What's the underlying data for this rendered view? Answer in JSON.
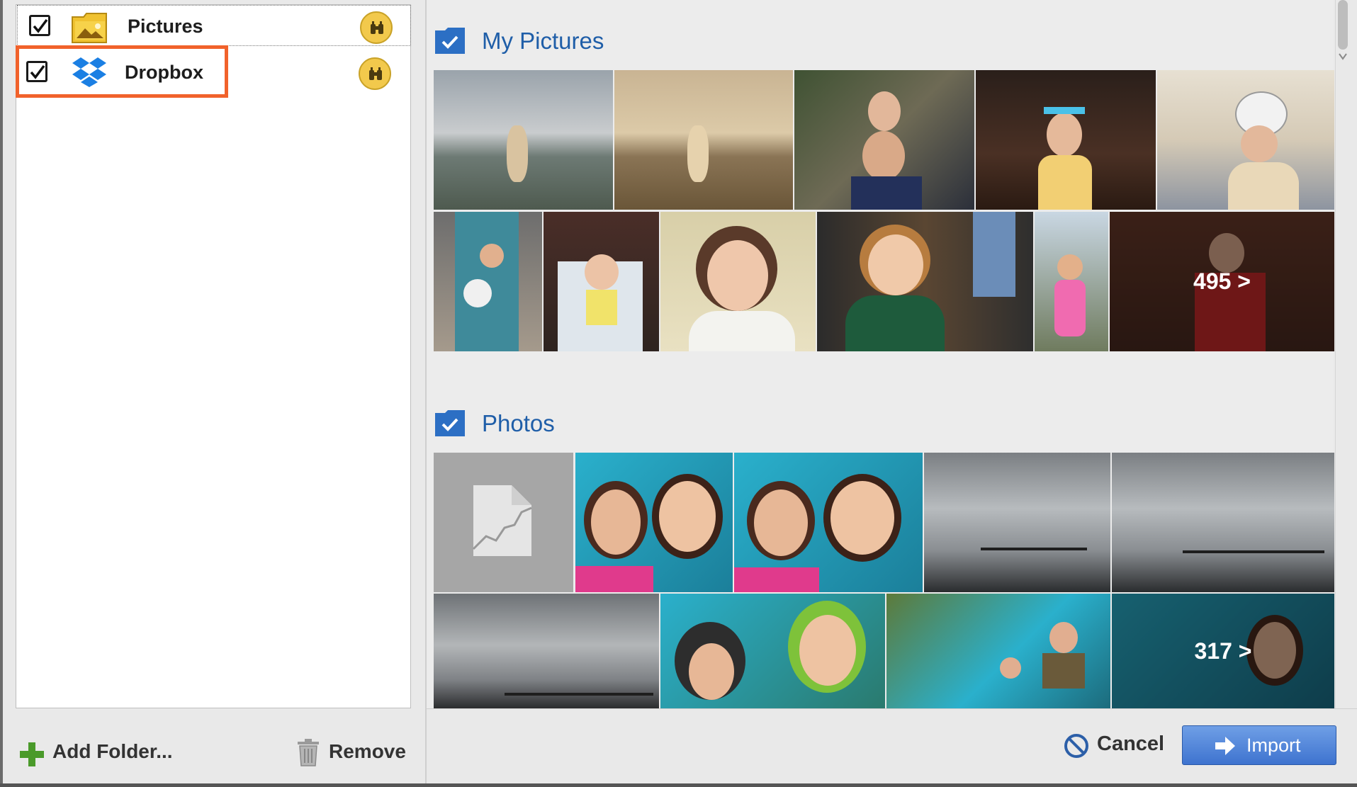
{
  "sources": [
    {
      "label": "Pictures",
      "checked": true,
      "icon": "pictures-folder-icon"
    },
    {
      "label": "Dropbox",
      "checked": true,
      "icon": "dropbox-icon"
    }
  ],
  "left_actions": {
    "add_folder": "Add Folder...",
    "remove": "Remove"
  },
  "sections": [
    {
      "title": "My Pictures",
      "more_count": "495 >"
    },
    {
      "title": "Photos",
      "more_count": "317 >"
    }
  ],
  "footer": {
    "cancel": "Cancel",
    "import": "Import"
  },
  "colors": {
    "accent": "#1f5ea8",
    "highlight": "#f1622b",
    "import_button": "#4a7fd6",
    "binoculars": "#f2c94c"
  }
}
